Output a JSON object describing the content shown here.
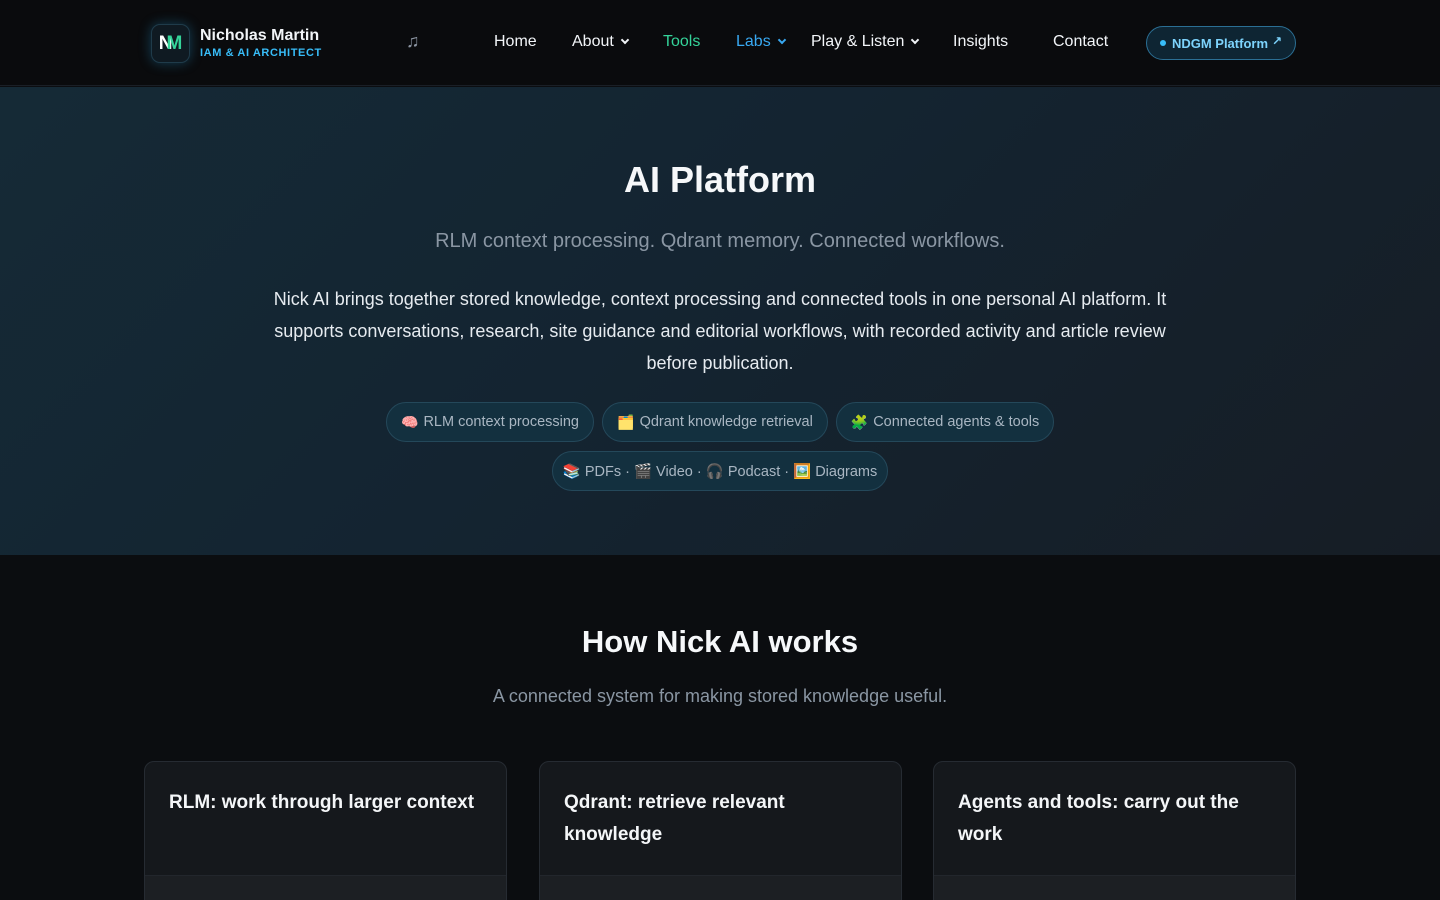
{
  "nav": {
    "brand_initials_a": "N",
    "brand_initials_b": "M",
    "brand_name": "Nicholas Martin",
    "brand_subtitle": "IAM & AI ARCHITECT",
    "music_icon": "music-note-icon",
    "items": [
      {
        "label": "Home"
      },
      {
        "label": "About"
      },
      {
        "label": "Tools"
      },
      {
        "label": "Labs"
      },
      {
        "label": "Play & Listen"
      },
      {
        "label": "Insights"
      },
      {
        "label": "Contact"
      }
    ],
    "platform_button": "NDGM Platform",
    "colors": {
      "active_tools": "#34d399",
      "labs": "#38a9f2",
      "accent": "#38bdf8"
    }
  },
  "hero": {
    "title": "AI Platform",
    "tagline": "RLM context processing. Qdrant memory. Connected workflows.",
    "description": "Nick AI brings together stored knowledge, context processing and connected tools in one personal AI platform. It supports conversations, research, site guidance and editorial workflows, with recorded activity and article review before publication.",
    "chips": [
      {
        "icon": "🧠",
        "label": "RLM context processing"
      },
      {
        "icon": "🗂️",
        "label": "Qdrant knowledge retrieval"
      },
      {
        "icon": "🧩",
        "label": "Connected agents & tools"
      }
    ],
    "media_chip": "📚 PDFs · 🎬 Video · 🎧 Podcast · 🖼️ Diagrams"
  },
  "how": {
    "title": "How Nick AI works",
    "subtitle": "A connected system for making stored knowledge useful.",
    "cards": [
      {
        "title": "RLM: work through larger context"
      },
      {
        "title": "Qdrant: retrieve relevant knowledge"
      },
      {
        "title": "Agents and tools: carry out the work"
      }
    ]
  }
}
